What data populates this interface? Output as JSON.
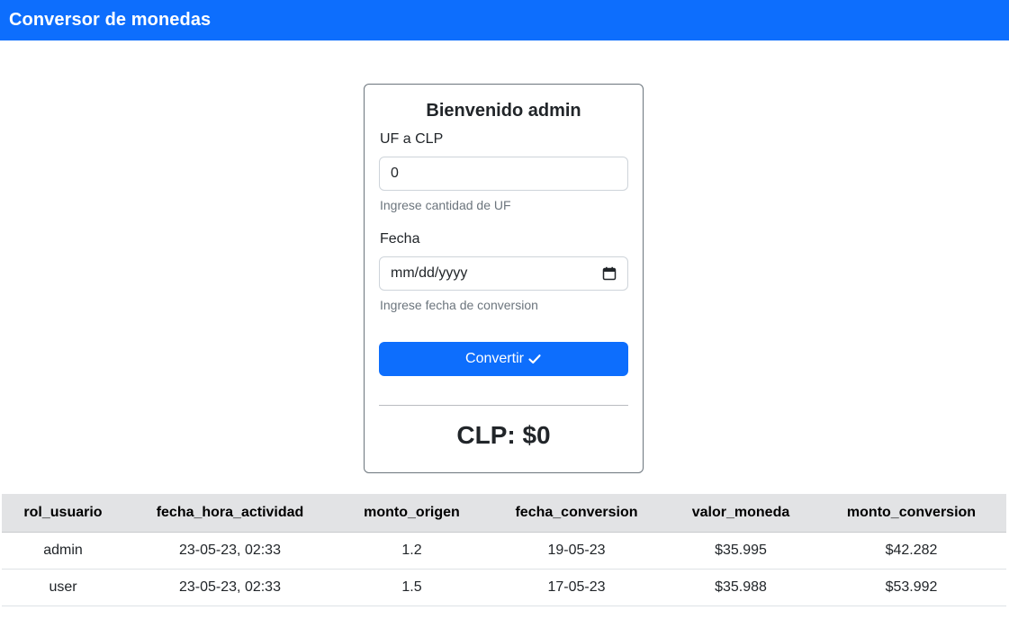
{
  "navbar": {
    "brand": "Conversor de monedas"
  },
  "card": {
    "title": "Bienvenido admin",
    "uf_field": {
      "label": "UF a CLP",
      "value": "0",
      "help": "Ingrese cantidad de UF"
    },
    "date_field": {
      "label": "Fecha",
      "placeholder": "mm/dd/yyyy",
      "help": "Ingrese fecha de conversion",
      "icon": "calendar-icon"
    },
    "convert_button": {
      "label": "Convertir",
      "icon": "check-icon"
    },
    "result": "CLP: $0"
  },
  "table": {
    "headers": [
      "rol_usuario",
      "fecha_hora_actividad",
      "monto_origen",
      "fecha_conversion",
      "valor_moneda",
      "monto_conversion"
    ],
    "rows": [
      [
        "admin",
        "23-05-23, 02:33",
        "1.2",
        "19-05-23",
        "$35.995",
        "$42.282"
      ],
      [
        "user",
        "23-05-23, 02:33",
        "1.5",
        "17-05-23",
        "$35.988",
        "$53.992"
      ]
    ]
  },
  "colors": {
    "primary": "#0d6efd",
    "table_header_bg": "#e2e3e5",
    "muted_text": "#6c757d"
  }
}
